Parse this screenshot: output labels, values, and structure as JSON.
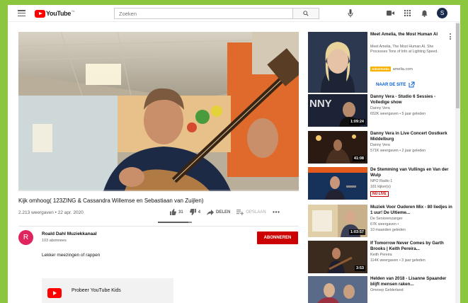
{
  "header": {
    "logo_text": "YouTube",
    "logo_country": "NL",
    "search_placeholder": "Zoeken",
    "avatar_initial": "S"
  },
  "video": {
    "title": "Kijk omhoog( 123ZING & Cassandra Willemse en Sebastiaan van Zuijlen)",
    "views_date": "2.213 weergaven • 22 apr. 2020",
    "likes": "31",
    "dislikes": "4",
    "share_label": "DELEN",
    "save_label": "OPSLAAN",
    "like_ratio": 0.886
  },
  "channel": {
    "initial": "R",
    "name": "Roald Dahl Muziekkanaal",
    "subscribers": "103 abonnees",
    "subscribe_label": "ABONNEREN",
    "description": "Lekker meezingen of rappen"
  },
  "kids_promo": {
    "text": "Probeer YouTube Kids"
  },
  "ad": {
    "title": "Meet Amelia, the Most Human AI",
    "description": "Meet Amelia, The Most Human AI. She Processes Tons of Info at Lighting Speed.",
    "badge": "Advertentie",
    "domain": "amelia.com",
    "cta": "NAAR DE SITE"
  },
  "recommendations": [
    {
      "title": "Danny Vera - Studio 6 Sessies - Volledige show",
      "channel": "Danny Vera",
      "meta": "652K weergaven • 5 jaar geleden",
      "duration": "1:09:24",
      "thumb_color": "#1d2336"
    },
    {
      "title": "Danny Vera in Live Concert Oostkerk Middelburg",
      "channel": "Danny Vera",
      "meta": "571K weergaven • 2 jaar geleden",
      "duration": "41:08",
      "thumb_color": "#2a1a12"
    },
    {
      "title": "De Stemming van Vullings en Van der Wulp",
      "channel": "NPO Radio 1",
      "meta": "181 kijker(s)",
      "duration": "",
      "new": "NU LIVE",
      "thumb_color": "#16315a"
    },
    {
      "title": "Muziek Voor Ouderen Mix - 80 liedjes in 1 uur! De Ultieme...",
      "channel": "De Seniorenzanger",
      "meta": "67K weergaven •",
      "meta2": "10 maanden geleden",
      "duration": "1:03:57",
      "thumb_color": "#c8b08a"
    },
    {
      "title": "If Tomorrow Never Comes by Garth Brooks | Keith Pereira...",
      "channel": "Keith Pereira",
      "meta": "114K weergaven • 3 jaar geleden",
      "duration": "3:53",
      "thumb_color": "#3b2a1e"
    },
    {
      "title": "Helden van 2018 - Lisanne Spaander blijft mensen raken...",
      "channel": "Omroep Gelderland",
      "meta": "",
      "duration": "",
      "thumb_color": "#5a6b8a"
    }
  ]
}
